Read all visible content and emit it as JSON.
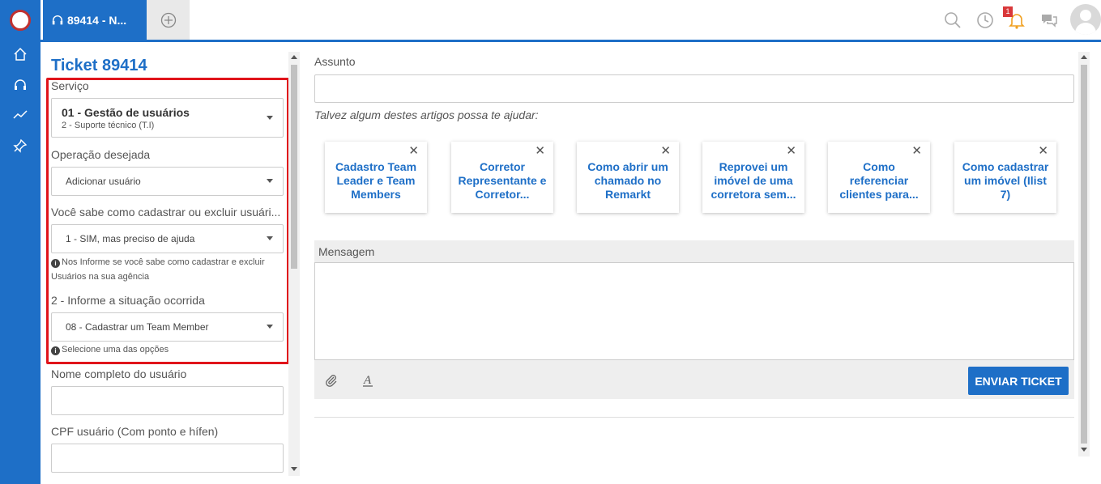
{
  "topbar": {
    "active_tab": "89414 - N...",
    "notification_count": "1"
  },
  "ticket": {
    "title": "Ticket 89414"
  },
  "form": {
    "servico_label": "Serviço",
    "servico_main": "01 - Gestão de usuários",
    "servico_sub": "2 - Suporte técnico (T.I)",
    "operacao_label": "Operação desejada",
    "operacao_value": "Adicionar usuário",
    "sabe_label": "Você sabe como cadastrar ou excluir usuári...",
    "sabe_value": "1 - SIM, mas preciso de ajuda",
    "sabe_hint": "Nos Informe se você sabe como cadastrar e excluir Usuários na sua agência",
    "situacao_label": "2 - Informe a situação ocorrida",
    "situacao_value": "08 - Cadastrar um Team Member",
    "situacao_hint": "Selecione uma das opções",
    "nome_label": "Nome completo do usuário",
    "cpf_label": "CPF usuário (Com ponto e hífen)"
  },
  "main": {
    "subject_label": "Assunto",
    "articles_hint": "Talvez algum destes artigos possa te ajudar:",
    "articles": [
      {
        "title": "Cadastro Team Leader e Team Members"
      },
      {
        "title": "Corretor Representante e Corretor..."
      },
      {
        "title": "Como abrir um chamado no Remarkt"
      },
      {
        "title": "Reprovei um imóvel de uma corretora sem..."
      },
      {
        "title": "Como referenciar clientes para..."
      },
      {
        "title": "Como cadastrar um imóvel (Ilist 7)"
      }
    ],
    "message_label": "Mensagem",
    "send_label": "ENVIAR TICKET"
  },
  "colors": {
    "brand": "#1e6fc7",
    "highlight": "#e0141b"
  }
}
